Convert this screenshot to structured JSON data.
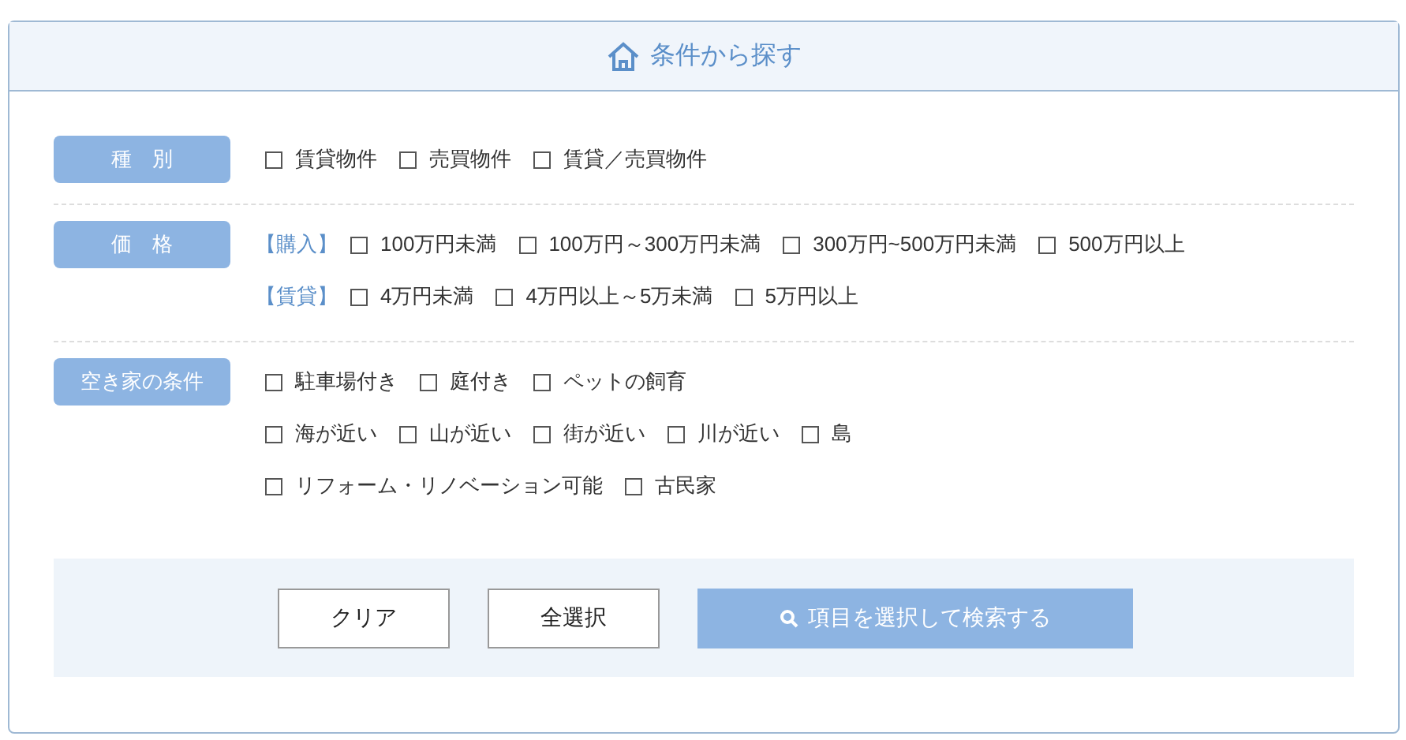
{
  "header": {
    "title": "条件から探す"
  },
  "sections": [
    {
      "label": "種　別",
      "lines": [
        {
          "options": [
            {
              "label": "賃貸物件",
              "checked": false
            },
            {
              "label": "売買物件",
              "checked": false
            },
            {
              "label": "賃貸／売買物件",
              "checked": false
            }
          ]
        }
      ]
    },
    {
      "label": "価　格",
      "lines": [
        {
          "prefix": "【購入】",
          "options": [
            {
              "label": "100万円未満",
              "checked": false
            },
            {
              "label": "100万円～300万円未満",
              "checked": false
            },
            {
              "label": "300万円~500万円未満",
              "checked": false
            },
            {
              "label": "500万円以上",
              "checked": false
            }
          ]
        },
        {
          "prefix": "【賃貸】",
          "options": [
            {
              "label": "4万円未満",
              "checked": false
            },
            {
              "label": "4万円以上～5万未満",
              "checked": false
            },
            {
              "label": "5万円以上",
              "checked": false
            }
          ]
        }
      ]
    },
    {
      "label": "空き家の条件",
      "lines": [
        {
          "options": [
            {
              "label": "駐車場付き",
              "checked": false
            },
            {
              "label": "庭付き",
              "checked": false
            },
            {
              "label": "ペットの飼育",
              "checked": false
            }
          ]
        },
        {
          "options": [
            {
              "label": "海が近い",
              "checked": false
            },
            {
              "label": "山が近い",
              "checked": false
            },
            {
              "label": "街が近い",
              "checked": false
            },
            {
              "label": "川が近い",
              "checked": false
            },
            {
              "label": "島",
              "checked": false
            }
          ]
        },
        {
          "options": [
            {
              "label": "リフォーム・リノベーション可能",
              "checked": false
            },
            {
              "label": "古民家",
              "checked": false
            }
          ]
        }
      ]
    }
  ],
  "buttons": {
    "clear": "クリア",
    "select_all": "全選択",
    "search": "項目を選択して検索する"
  }
}
